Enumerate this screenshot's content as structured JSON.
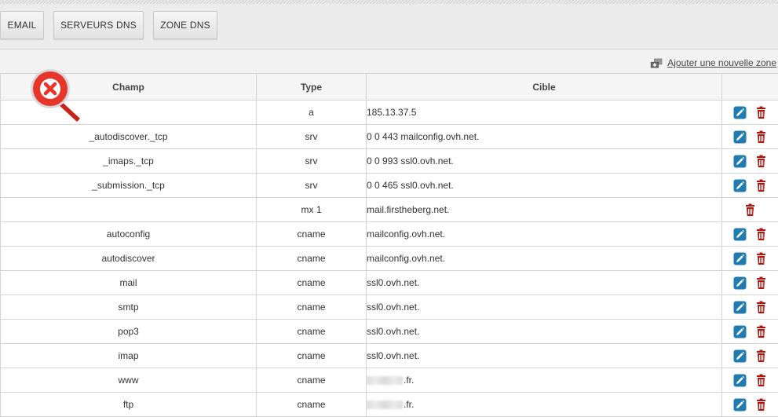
{
  "tabs": [
    {
      "label": "EMAIL"
    },
    {
      "label": "SERVEURS DNS"
    },
    {
      "label": "ZONE DNS"
    }
  ],
  "add_zone_label": "Ajouter une nouvelle zone",
  "table": {
    "headers": {
      "champ": "Champ",
      "type": "Type",
      "cible": "Cible"
    },
    "rows": [
      {
        "champ": "",
        "type": "a",
        "cible": "185.13.37.5",
        "editable": true
      },
      {
        "champ": "_autodiscover._tcp",
        "type": "srv",
        "cible": "0 0 443 mailconfig.ovh.net.",
        "editable": true
      },
      {
        "champ": "_imaps._tcp",
        "type": "srv",
        "cible": "0 0 993 ssl0.ovh.net.",
        "editable": true
      },
      {
        "champ": "_submission._tcp",
        "type": "srv",
        "cible": "0 0 465 ssl0.ovh.net.",
        "editable": true
      },
      {
        "champ": "",
        "type": "mx 1",
        "cible": "mail.firstheberg.net.",
        "editable": false
      },
      {
        "champ": "autoconfig",
        "type": "cname",
        "cible": "mailconfig.ovh.net.",
        "editable": true
      },
      {
        "champ": "autodiscover",
        "type": "cname",
        "cible": "mailconfig.ovh.net.",
        "editable": true
      },
      {
        "champ": "mail",
        "type": "cname",
        "cible": "ssl0.ovh.net.",
        "editable": true
      },
      {
        "champ": "smtp",
        "type": "cname",
        "cible": "ssl0.ovh.net.",
        "editable": true
      },
      {
        "champ": "pop3",
        "type": "cname",
        "cible": "ssl0.ovh.net.",
        "editable": true
      },
      {
        "champ": "imap",
        "type": "cname",
        "cible": "ssl0.ovh.net.",
        "editable": true
      },
      {
        "champ": "www",
        "type": "cname",
        "cible": ".fr.",
        "cible_redacted": true,
        "editable": true
      },
      {
        "champ": "ftp",
        "type": "cname",
        "cible": ".fr.",
        "cible_redacted": true,
        "editable": true
      }
    ]
  },
  "icons": {
    "edit": "pencil-icon",
    "delete": "trash-icon",
    "error": "error-x-icon",
    "add_zone": "add-zone-icon"
  },
  "colors": {
    "edit_bg": "#1f7bb0",
    "delete": "#b5120c",
    "error_badge": "#e8352a"
  }
}
